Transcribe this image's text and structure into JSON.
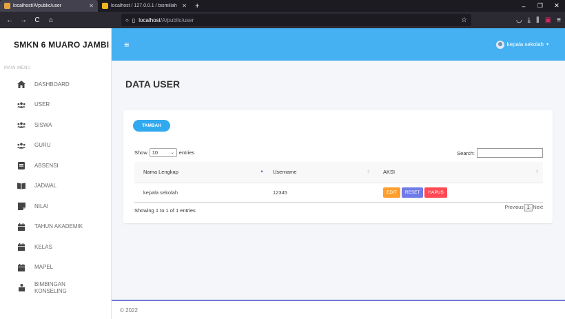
{
  "browser": {
    "tabs": [
      {
        "title": "localhost/A/public/user",
        "active": true,
        "favicon_color": "#e8a33d"
      },
      {
        "title": "localhost / 127.0.0.1 / bismillah",
        "active": false,
        "favicon_color": "#f0b322"
      }
    ],
    "new_tab": "+",
    "window_controls": {
      "minimize": "–",
      "maximize": "❐",
      "close": "✕"
    },
    "nav": {
      "back": "←",
      "forward": "→",
      "reload": "C",
      "home": "⌂"
    },
    "url": {
      "host": "localhost",
      "path": "/A/public/user"
    }
  },
  "sidebar": {
    "brand": "SMKN 6 MUARO JAMBI",
    "menu_header": "MAIN MENU",
    "items": [
      {
        "label": "DASHBOARD",
        "icon": "home-icon"
      },
      {
        "label": "USER",
        "icon": "users-icon"
      },
      {
        "label": "SISWA",
        "icon": "users-icon"
      },
      {
        "label": "GURU",
        "icon": "users-icon"
      },
      {
        "label": "ABSENSI",
        "icon": "clipboard-icon"
      },
      {
        "label": "JADWAL",
        "icon": "book-icon"
      },
      {
        "label": "NILAI",
        "icon": "note-icon"
      },
      {
        "label": "TAHUN AKADEMIK",
        "icon": "calendar-icon"
      },
      {
        "label": "KELAS",
        "icon": "calendar-icon"
      },
      {
        "label": "MAPEL",
        "icon": "calendar-icon"
      },
      {
        "label": "BIMBINGAN KONSELING",
        "icon": "person-board-icon"
      }
    ]
  },
  "header": {
    "menu_icon": "≡",
    "user_name": "kepala sekolah",
    "accent": "#45b0f2"
  },
  "page": {
    "title": "DATA USER",
    "add_button": "TAMBAH",
    "show_label": "Show",
    "entries_value": "10",
    "entries_label": "entries",
    "search_label": "Search:",
    "search_value": "",
    "columns": [
      "Nama Lengkap",
      "Username",
      "AKSI"
    ],
    "rows": [
      {
        "nama": "kepala sekolah",
        "username": "12345"
      }
    ],
    "actions": {
      "edit": "EDIT",
      "reset": "RESET",
      "hapus": "HAPUS"
    },
    "info": "Showing 1 to 1 of 1 entries",
    "pager": {
      "previous": "Previous",
      "current": "1",
      "next": "Next"
    }
  },
  "footer": {
    "text": "© 2022"
  }
}
